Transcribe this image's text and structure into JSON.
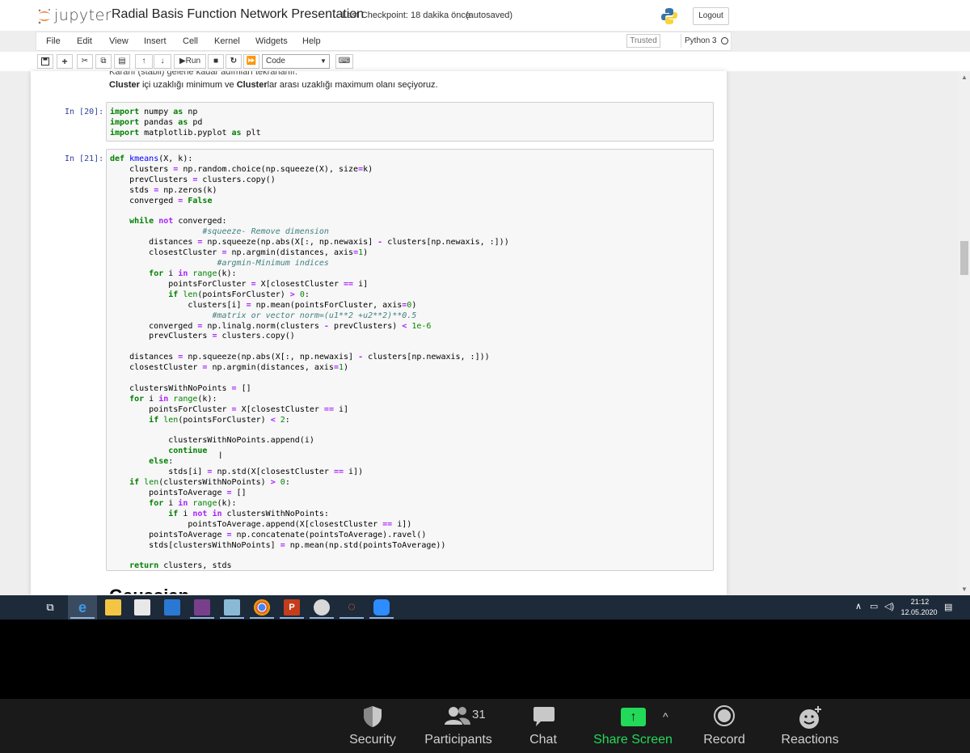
{
  "jupyter": {
    "logo_text": "jupyter",
    "title": "Radial Basis Function Network Presentation",
    "checkpoint": "Last Checkpoint: 18 dakika önce",
    "autosaved": "(autosaved)",
    "logout": "Logout",
    "menu": [
      "File",
      "Edit",
      "View",
      "Insert",
      "Cell",
      "Kernel",
      "Widgets",
      "Help"
    ],
    "trusted": "Trusted",
    "kernel": "Python 3",
    "toolbar": {
      "run_label": "Run",
      "cell_type": "Code",
      "icons": [
        "save-icon",
        "add-cell-icon",
        "cut-icon",
        "copy-icon",
        "paste-icon",
        "move-up-icon",
        "move-down-icon",
        "run-icon",
        "stop-icon",
        "restart-icon",
        "fast-forward-icon",
        "keyboard-icon"
      ]
    }
  },
  "notebook": {
    "markdown_line1": "Kararlı (stabil) gelene kadar adımları tekrarlanır.",
    "markdown_line2_bold1": "Cluster",
    "markdown_line2_mid": " içi uzaklığı minimum ve ",
    "markdown_line2_bold2": "Cluster",
    "markdown_line2_end": "lar arası uzaklığı maximum olanı seçiyoruz.",
    "cell1_prompt": "In [20]:",
    "cell2_prompt": "In [21]:",
    "next_heading": "Gaussian"
  },
  "taskbar": {
    "icons": [
      "task-view-icon",
      "edge-icon",
      "file-explorer-icon",
      "store-icon",
      "mail-icon",
      "winrar-icon",
      "notepad-icon",
      "chrome-icon",
      "powerpoint-icon",
      "paint-icon",
      "jupyter-taskbar-icon",
      "zoom-taskbar-icon"
    ],
    "time": "21:12",
    "date": "12.05.2020"
  },
  "zoom_bar": {
    "security": "Security",
    "participants": "Participants",
    "participants_count": "31",
    "chat": "Chat",
    "share_screen": "Share Screen",
    "record": "Record",
    "reactions": "Reactions",
    "share_color": "#23d959"
  }
}
